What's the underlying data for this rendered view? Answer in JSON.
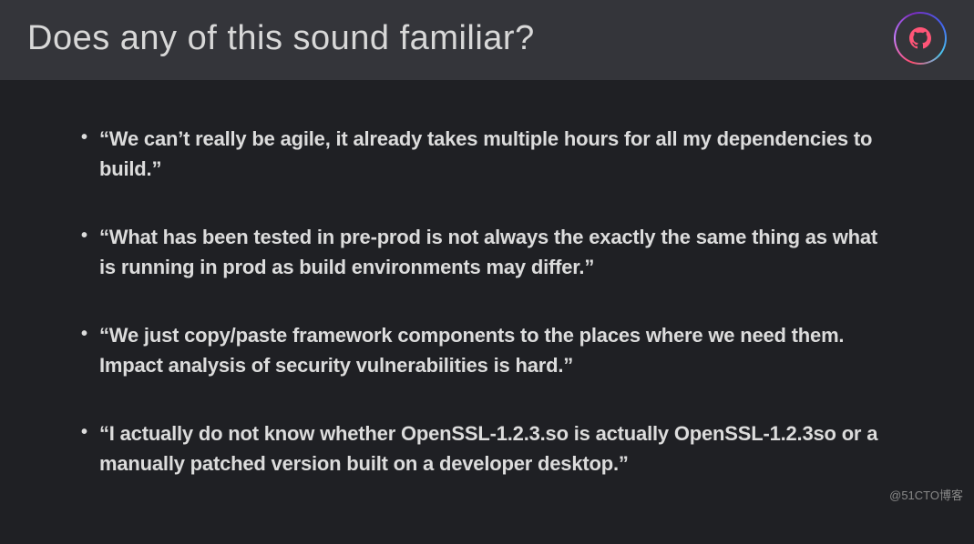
{
  "header": {
    "title": "Does any of this sound familiar?"
  },
  "bullets": [
    "“We can’t really be agile, it already takes multiple hours for all my dependencies to build.”",
    "“What has been tested in pre-prod is not always the exactly the same thing as what is running in prod as build environments may differ.”",
    "“We just copy/paste framework components to the places where we need them. Impact analysis of security vulnerabilities is hard.”",
    "“I actually do not know whether OpenSSL-1.2.3.so is actually OpenSSL-1.2.3so or a manually patched version built on a developer desktop.”"
  ],
  "watermark": "@51CTO博客"
}
